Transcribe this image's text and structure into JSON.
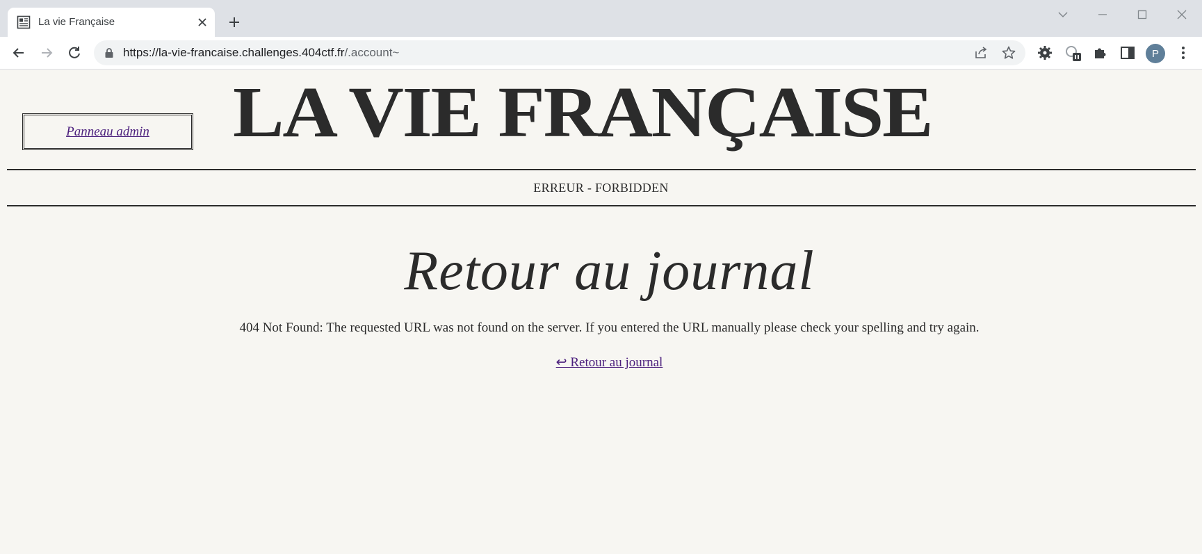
{
  "browser": {
    "tab": {
      "title": "La vie Française",
      "favicon": "newspaper-icon"
    },
    "address": {
      "host": "https://la-vie-francaise.challenges.404ctf.fr",
      "path": "/.account~"
    },
    "avatar_letter": "P"
  },
  "header": {
    "admin_link": "Panneau admin",
    "masthead": "LA VIE FRANÇAISE",
    "section": "ERREUR - FORBIDDEN"
  },
  "main": {
    "title": "Retour au journal",
    "message": "404 Not Found: The requested URL was not found on the server. If you entered the URL manually please check your spelling and try again.",
    "back_link": "↩ Retour au journal"
  },
  "colors": {
    "page_bg": "#f7f6f2",
    "text": "#2b2b2b",
    "link": "#4b1f7d"
  }
}
